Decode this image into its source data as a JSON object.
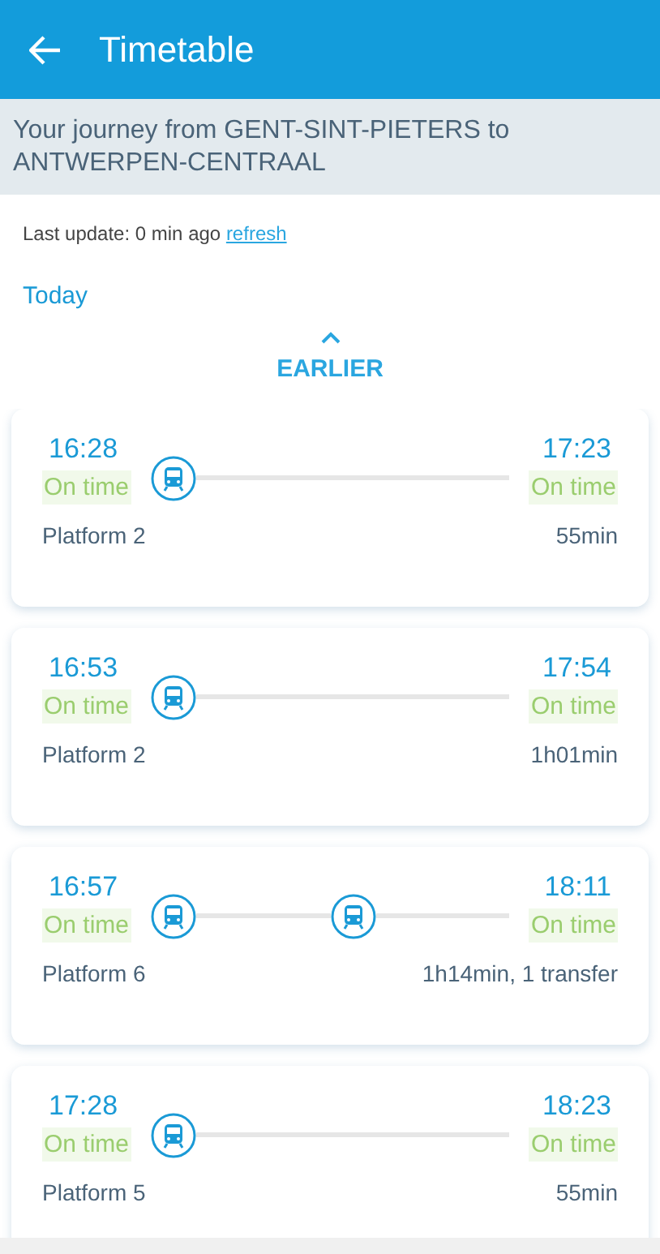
{
  "header": {
    "title": "Timetable"
  },
  "journey": "Your journey from GENT-SINT-PIETERS to ANTWERPEN-CENTRAAL",
  "last_update": {
    "text": "Last update: 0 min ago",
    "link": "refresh"
  },
  "day": "Today",
  "earlier": "EARLIER",
  "connections": [
    {
      "departure": "16:28",
      "departure_status": "On time",
      "arrival": "17:23",
      "arrival_status": "On time",
      "platform": "Platform 2",
      "duration": "55min",
      "legs": [
        {
          "kind": "train"
        }
      ]
    },
    {
      "departure": "16:53",
      "departure_status": "On time",
      "arrival": "17:54",
      "arrival_status": "On time",
      "platform": "Platform 2",
      "duration": "1h01min",
      "legs": [
        {
          "kind": "train"
        }
      ]
    },
    {
      "departure": "16:57",
      "departure_status": "On time",
      "arrival": "18:11",
      "arrival_status": "On time",
      "platform": "Platform 6",
      "duration": "1h14min, 1 transfer",
      "legs": [
        {
          "kind": "train"
        },
        {
          "kind": "train"
        }
      ]
    },
    {
      "departure": "17:28",
      "departure_status": "On time",
      "arrival": "18:23",
      "arrival_status": "On time",
      "platform": "Platform 5",
      "duration": "55min",
      "legs": [
        {
          "kind": "train"
        }
      ]
    }
  ]
}
